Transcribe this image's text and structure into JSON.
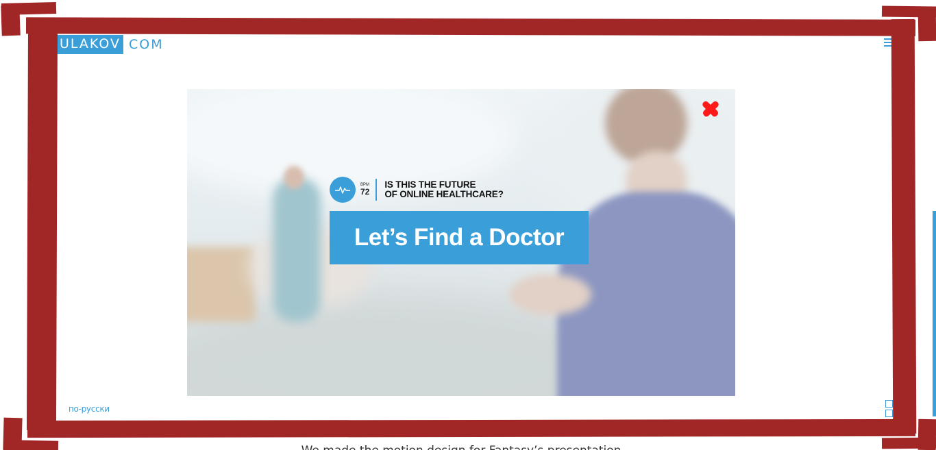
{
  "header": {
    "logo_box": "ULAKOV",
    "logo_rest": "COM",
    "menu_icon": "menu-icon"
  },
  "video": {
    "close_icon": "close-icon",
    "pulse_icon": "pulse-icon",
    "bpm_label": "BPM",
    "bpm_value": "72",
    "tagline_line1": "IS THIS THE FUTURE",
    "tagline_line2": "OF ONLINE HEALTHCARE?",
    "cta_label": "Let’s Find a Doctor"
  },
  "footer": {
    "language_link": "по-русски",
    "grid_icon": "grid-icon",
    "caption": "We made the motion design for Fantasy’s presentation"
  },
  "colors": {
    "accent": "#3a9ed8",
    "frame": "#a12727",
    "close": "#ff1a1a"
  }
}
